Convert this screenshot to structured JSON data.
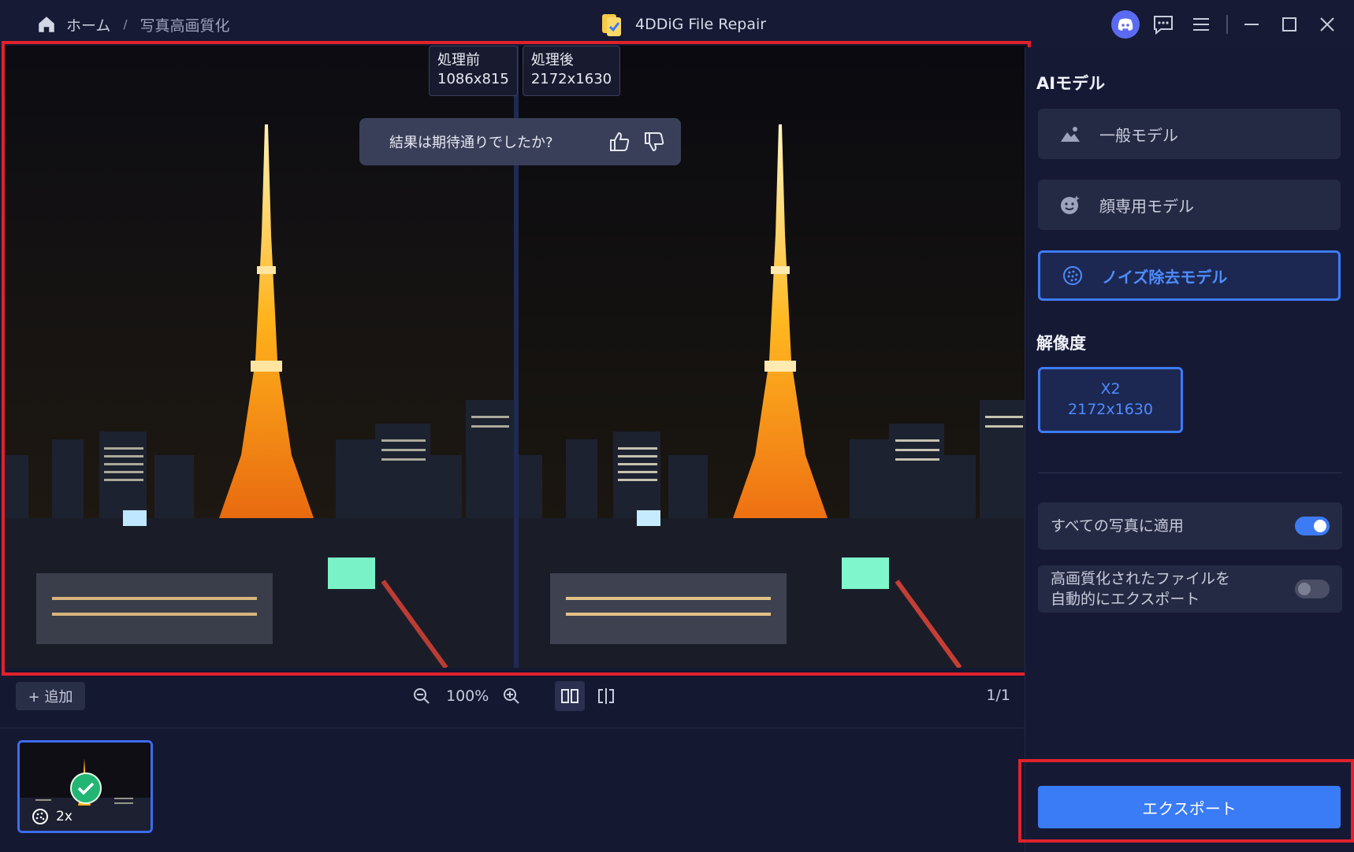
{
  "breadcrumb": {
    "home": "ホーム",
    "separator": "/",
    "current": "写真高画質化"
  },
  "app": {
    "title": "4DDiG File Repair"
  },
  "compare": {
    "before_label": "処理前",
    "before_size": "1086x815",
    "after_label": "処理後",
    "after_size": "2172x1630"
  },
  "feedback": {
    "question": "結果は期待通りでしたか?"
  },
  "toolbar": {
    "add_label": "+ 追加",
    "zoom": "100%",
    "page": "1/1"
  },
  "thumbnail": {
    "scale_badge": "2x"
  },
  "panel": {
    "ai_model_title": "AIモデル",
    "models": [
      {
        "label": "一般モデル",
        "icon": "landscape-icon",
        "selected": false
      },
      {
        "label": "顔専用モデル",
        "icon": "face-icon",
        "selected": false
      },
      {
        "label": "ノイズ除去モデル",
        "icon": "denoise-icon",
        "selected": true
      }
    ],
    "resolution_title": "解像度",
    "resolution": {
      "scale": "X2",
      "size": "2172x1630"
    },
    "apply_all": {
      "label": "すべての写真に適用",
      "on": true
    },
    "auto_export": {
      "line1": "高画質化されたファイルを",
      "line2": "自動的にエクスポート",
      "on": false
    },
    "export_label": "エクスポート"
  },
  "colors": {
    "accent": "#3a7bf6",
    "highlight_box": "#e0222b",
    "success": "#22b573"
  }
}
